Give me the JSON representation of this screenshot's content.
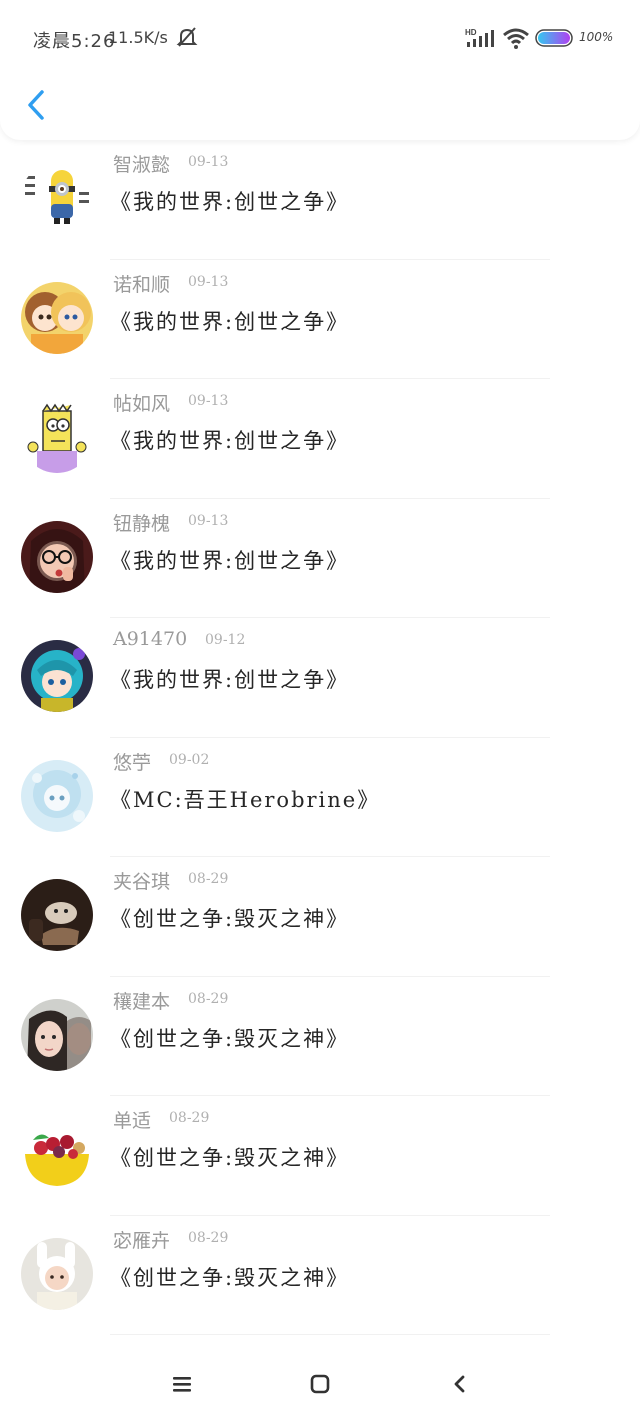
{
  "status_bar": {
    "time": "凌晨5:26",
    "net_speed": "11.5K/s",
    "battery": "100%",
    "icons": [
      "mute-icon",
      "hd-icon",
      "signal-icon",
      "wifi-icon",
      "battery-icon"
    ]
  },
  "header": {
    "back_icon": "chevron-left-icon",
    "accent_color": "#2f9ef0"
  },
  "items": [
    {
      "name": "智淑懿",
      "date": "09-13",
      "title": "《我的世界:创世之争》",
      "avatar": "minion"
    },
    {
      "name": "诺和顺",
      "date": "09-13",
      "title": "《我的世界:创世之争》",
      "avatar": "anime-duo"
    },
    {
      "name": "帖如风",
      "date": "09-13",
      "title": "《我的世界:创世之争》",
      "avatar": "cartoon"
    },
    {
      "name": "钮静槐",
      "date": "09-13",
      "title": "《我的世界:创世之争》",
      "avatar": "glasses-girl"
    },
    {
      "name": "A91470",
      "date": "09-12",
      "title": "《我的世界:创世之争》",
      "avatar": "teal-hair"
    },
    {
      "name": "悠苧",
      "date": "09-02",
      "title": "《MC:吾王Herobrine》",
      "avatar": "pale-blue"
    },
    {
      "name": "夹谷琪",
      "date": "08-29",
      "title": "《创世之争:毁灭之神》",
      "avatar": "dark-pet"
    },
    {
      "name": "穰建本",
      "date": "08-29",
      "title": "《创世之争:毁灭之神》",
      "avatar": "face-girl"
    },
    {
      "name": "单适",
      "date": "08-29",
      "title": "《创世之争:毁灭之神》",
      "avatar": "fruit-bowl"
    },
    {
      "name": "宓雁卉",
      "date": "08-29",
      "title": "《创世之争:毁灭之神》",
      "avatar": "bunny-hat"
    }
  ],
  "nav_bar": {
    "icons": [
      "menu-icon",
      "home-icon",
      "back-icon"
    ]
  }
}
